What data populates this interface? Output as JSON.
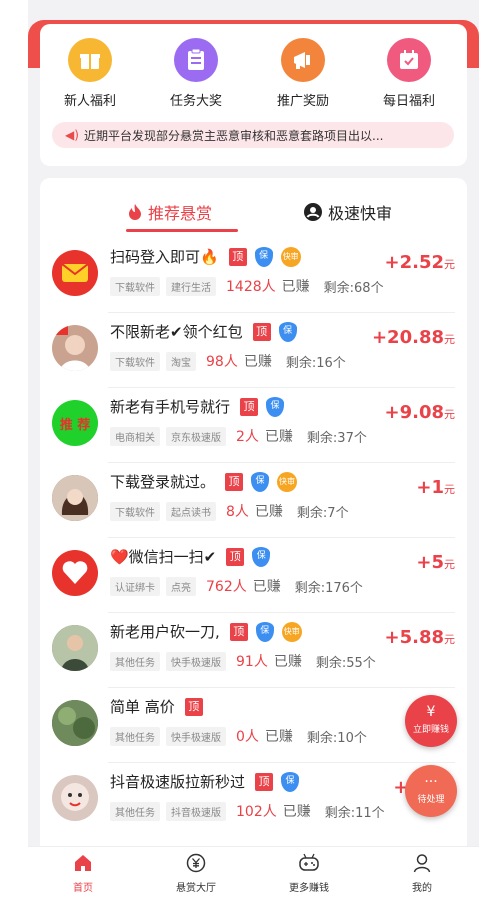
{
  "quick_links": [
    {
      "label": "新人福利",
      "icon": "gift-icon",
      "color": "#f7b733"
    },
    {
      "label": "任务大奖",
      "icon": "clipboard-icon",
      "color": "#9b6cf2"
    },
    {
      "label": "推广奖励",
      "icon": "megaphone-icon",
      "color": "#f2853b"
    },
    {
      "label": "每日福利",
      "icon": "calendar-check-icon",
      "color": "#f05a7e"
    }
  ],
  "notice": {
    "text": "近期平台发现部分悬赏主恶意审核和恶意套路项目出以..."
  },
  "tabs": {
    "recommended": "推荐悬赏",
    "fast_review": "极速快审"
  },
  "badges": {
    "top": "顶",
    "shield": "保",
    "coin": "快审"
  },
  "tasks": [
    {
      "title": "扫码登入即可🔥",
      "tags": [
        "下载软件",
        "建行生活"
      ],
      "takers": "1428人",
      "takers_suffix": "已赚",
      "remaining": "剩余:68个",
      "reward_amount": "+2.52",
      "reward_unit": "元",
      "avatar_color": "#e8322c",
      "has_shield": true,
      "has_coin": true
    },
    {
      "title": "不限新老✔领个红包",
      "tags": [
        "下载软件",
        "淘宝"
      ],
      "takers": "98人",
      "takers_suffix": "已赚",
      "remaining": "剩余:16个",
      "reward_amount": "+20.88",
      "reward_unit": "元",
      "avatar_color": "#c9a38f",
      "has_shield": true,
      "has_coin": false
    },
    {
      "title": "新老有手机号就行",
      "tags": [
        "电商相关",
        "京东极速版"
      ],
      "takers": "2人",
      "takers_suffix": "已赚",
      "remaining": "剩余:37个",
      "reward_amount": "+9.08",
      "reward_unit": "元",
      "avatar_color": "#1fd12a",
      "avatar_text": "推 荐",
      "has_shield": true,
      "has_coin": false
    },
    {
      "title": "下载登录就过。",
      "tags": [
        "下载软件",
        "起点读书"
      ],
      "takers": "8人",
      "takers_suffix": "已赚",
      "remaining": "剩余:7个",
      "reward_amount": "+1",
      "reward_unit": "元",
      "avatar_color": "#8b5e4a",
      "has_shield": true,
      "has_coin": true
    },
    {
      "title": "❤️微信扫一扫✔",
      "tags": [
        "认证绑卡",
        "点亮"
      ],
      "takers": "762人",
      "takers_suffix": "已赚",
      "remaining": "剩余:176个",
      "reward_amount": "+5",
      "reward_unit": "元",
      "avatar_color": "#e8322c",
      "has_shield": true,
      "has_coin": false
    },
    {
      "title": "新老用户砍一刀,",
      "tags": [
        "其他任务",
        "快手极速版"
      ],
      "takers": "91人",
      "takers_suffix": "已赚",
      "remaining": "剩余:55个",
      "reward_amount": "+5.88",
      "reward_unit": "元",
      "avatar_color": "#6c7a5e",
      "has_shield": true,
      "has_coin": true
    },
    {
      "title": "简单   高价",
      "tags": [
        "其他任务",
        "快手极速版"
      ],
      "takers": "0人",
      "takers_suffix": "已赚",
      "remaining": "剩余:10个",
      "reward_amount": "",
      "reward_unit": "",
      "avatar_color": "#5a6e4b",
      "has_shield": false,
      "has_coin": false
    },
    {
      "title": "抖音极速版拉新秒过",
      "tags": [
        "其他任务",
        "抖音极速版"
      ],
      "takers": "102人",
      "takers_suffix": "已赚",
      "remaining": "剩余:11个",
      "reward_amount": "+2",
      "reward_unit": "",
      "avatar_color": "#d9c7c0",
      "has_shield": true,
      "has_coin": false
    }
  ],
  "float_buttons": {
    "earn_now": {
      "icon": "¥",
      "label": "立即赚钱"
    },
    "pending": {
      "icon": "···",
      "label": "待处理"
    }
  },
  "bottom_nav": [
    {
      "label": "首页",
      "icon": "home-icon",
      "active": true
    },
    {
      "label": "悬赏大厅",
      "icon": "yen-circle-icon",
      "active": false
    },
    {
      "label": "更多赚钱",
      "icon": "gamepad-icon",
      "active": false
    },
    {
      "label": "我的",
      "icon": "user-icon",
      "active": false
    }
  ],
  "colors": {
    "accent": "#e94248",
    "header": "#ef4f4a"
  }
}
